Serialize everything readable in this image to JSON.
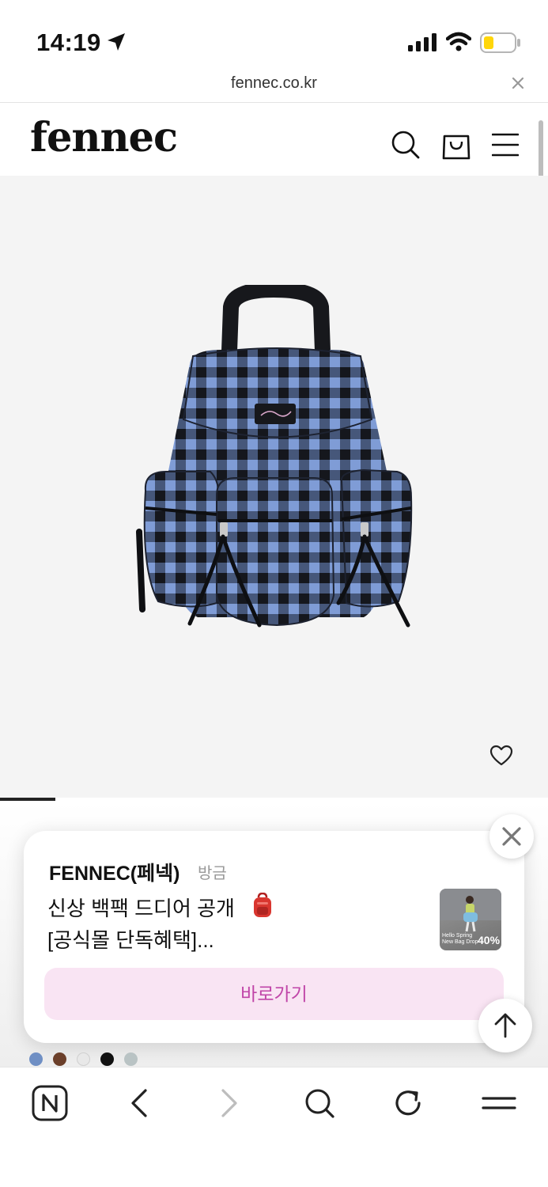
{
  "status_bar": {
    "time": "14:19",
    "battery_color": "#ffd60a"
  },
  "browser": {
    "url": "fennec.co.kr"
  },
  "site": {
    "logo": "fennec",
    "header_icons": [
      "search-icon",
      "shopping-bag-icon",
      "menu-icon"
    ]
  },
  "product": {
    "image": "blue-gingham-backpack",
    "pattern_colors": [
      "#7f9cd6",
      "#1b1d24"
    ]
  },
  "notification": {
    "sender": "FENNEC(페넥)",
    "time": "방금",
    "line1": "신상 백팩 드디어 공개",
    "line2": "[공식몰 단독혜택]...",
    "thumb_text_1": "Hello Spring",
    "thumb_text_2": "New Bag Drop",
    "thumb_percent": "40%",
    "cta": "바로가기",
    "cta_color": "#c045a8"
  },
  "color_swatches": [
    "#6f8fc4",
    "#6b3f2a",
    "#e8e8e8",
    "#111111",
    "#b9c3c4"
  ],
  "bottom_nav": [
    "naver-home-icon",
    "back-icon",
    "forward-icon",
    "search-icon",
    "refresh-icon",
    "menu-icon"
  ]
}
